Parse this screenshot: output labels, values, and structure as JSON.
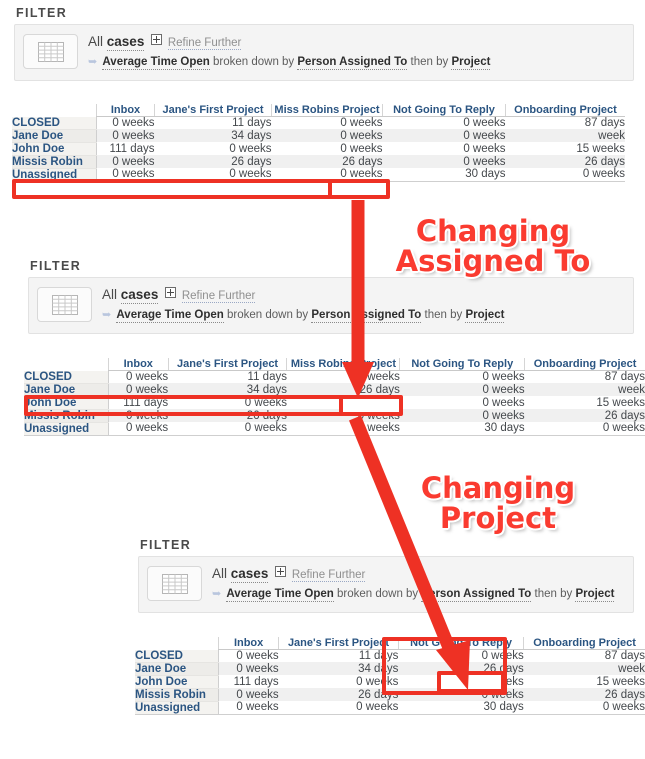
{
  "panels": [
    {
      "title": "FILTER",
      "icon": "grid-table-icon",
      "line1": {
        "all": "All",
        "subject": "cases",
        "expand_icon": "plus-box-icon",
        "refine": "Refine Further"
      },
      "line2": {
        "metric": "Average Time Open",
        "mid": " broken down by ",
        "dim1": "Person Assigned To",
        "conj": " then by ",
        "dim2": "Project"
      }
    },
    {
      "title": "FILTER",
      "icon": "grid-table-icon",
      "line1": {
        "all": "All",
        "subject": "cases",
        "expand_icon": "plus-box-icon",
        "refine": "Refine Further"
      },
      "line2": {
        "metric": "Average Time Open",
        "mid": " broken down by ",
        "dim1": "Person Assigned To",
        "conj": " then by ",
        "dim2": "Project"
      }
    },
    {
      "title": "FILTER",
      "icon": "grid-table-icon",
      "line1": {
        "all": "All",
        "subject": "cases",
        "expand_icon": "plus-box-icon",
        "refine": "Refine Further"
      },
      "line2": {
        "metric": "Average Time Open",
        "mid": " broken down by ",
        "dim1": "Person Assigned To",
        "conj": " then by ",
        "dim2": "Project"
      }
    }
  ],
  "tables": [
    {
      "columns": [
        "Inbox",
        "Jane's First Project",
        "Miss Robins Project",
        "Not Going To Reply",
        "Onboarding Project"
      ],
      "rows": [
        {
          "label": "CLOSED",
          "values": [
            "0 weeks",
            "11 days",
            "0 weeks",
            "0 weeks",
            "87 days"
          ]
        },
        {
          "label": "Jane Doe",
          "values": [
            "0 weeks",
            "34 days",
            "0 weeks",
            "0 weeks",
            "week"
          ]
        },
        {
          "label": "John Doe",
          "values": [
            "111 days",
            "0 weeks",
            "0 weeks",
            "0 weeks",
            "15 weeks"
          ]
        },
        {
          "label": "Missis Robin",
          "values": [
            "0 weeks",
            "26 days",
            "26 days",
            "0 weeks",
            "26 days"
          ]
        },
        {
          "label": "Unassigned",
          "values": [
            "0 weeks",
            "0 weeks",
            "0 weeks",
            "30 days",
            "0 weeks"
          ]
        }
      ]
    },
    {
      "columns": [
        "Inbox",
        "Jane's First Project",
        "Miss Robins Project",
        "Not Going To Reply",
        "Onboarding Project"
      ],
      "rows": [
        {
          "label": "CLOSED",
          "values": [
            "0 weeks",
            "11 days",
            "0 weeks",
            "0 weeks",
            "87 days"
          ]
        },
        {
          "label": "Jane Doe",
          "values": [
            "0 weeks",
            "34 days",
            "26 days",
            "0 weeks",
            "week"
          ]
        },
        {
          "label": "John Doe",
          "values": [
            "111 days",
            "0 weeks",
            "0 weeks",
            "0 weeks",
            "15 weeks"
          ]
        },
        {
          "label": "Missis Robin",
          "values": [
            "0 weeks",
            "26 days",
            "0 weeks",
            "0 weeks",
            "26 days"
          ]
        },
        {
          "label": "Unassigned",
          "values": [
            "0 weeks",
            "0 weeks",
            "0 weeks",
            "30 days",
            "0 weeks"
          ]
        }
      ]
    },
    {
      "columns": [
        "Inbox",
        "Jane's First Project",
        "Not Going To Reply",
        "Onboarding Project"
      ],
      "rows": [
        {
          "label": "CLOSED",
          "values": [
            "0 weeks",
            "11 days",
            "0 weeks",
            "87 days"
          ]
        },
        {
          "label": "Jane Doe",
          "values": [
            "0 weeks",
            "34 days",
            "26 days",
            "week"
          ]
        },
        {
          "label": "John Doe",
          "values": [
            "111 days",
            "0 weeks",
            "0 weeks",
            "15 weeks"
          ]
        },
        {
          "label": "Missis Robin",
          "values": [
            "0 weeks",
            "26 days",
            "0 weeks",
            "26 days"
          ]
        },
        {
          "label": "Unassigned",
          "values": [
            "0 weeks",
            "0 weeks",
            "30 days",
            "0 weeks"
          ]
        }
      ]
    }
  ],
  "annotations": [
    {
      "text": "Changing\nAssigned To",
      "color": "#fa3b30"
    },
    {
      "text": "Changing\nProject",
      "color": "#fa3b30"
    }
  ],
  "highlight_color": "#ee3124",
  "arrow_color": "#ee3124"
}
